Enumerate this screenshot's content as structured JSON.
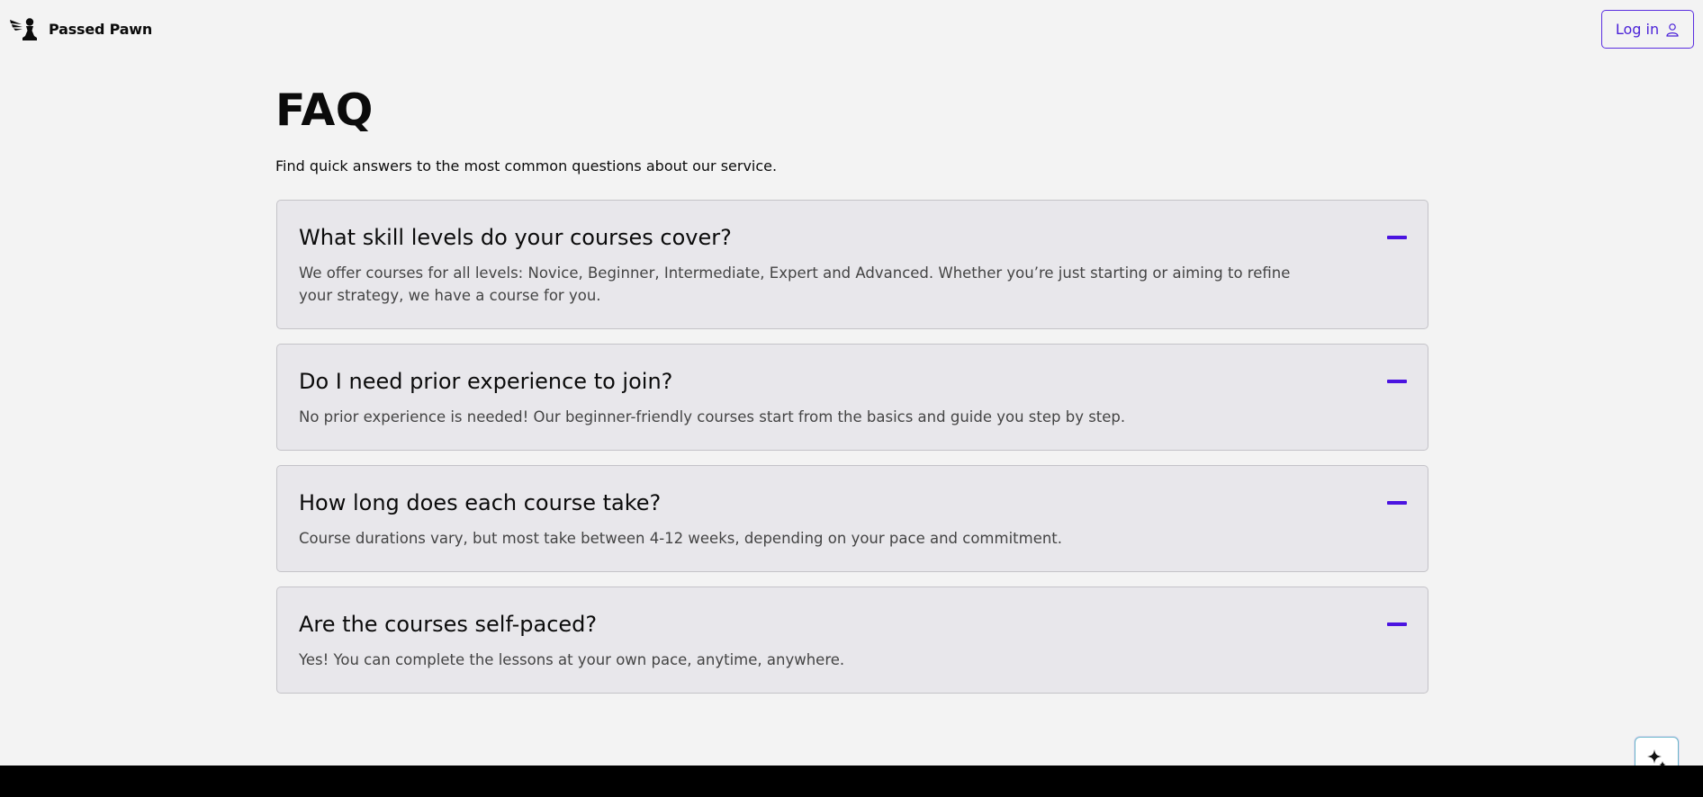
{
  "header": {
    "brand": "Passed Pawn",
    "login_label": "Log in",
    "logo_icon": "winged-pawn-icon",
    "login_icon": "user-icon"
  },
  "faq": {
    "title": "FAQ",
    "subtitle": "Find quick answers to the most common questions about our service.",
    "items": [
      {
        "question": "What skill levels do your courses cover?",
        "answer": "We offer courses for all levels: Novice, Beginner, Intermediate, Expert and Advanced. Whether you’re just starting or aiming to refine your strategy, we have a course for you."
      },
      {
        "question": "Do I need prior experience to join?",
        "answer": "No prior experience is needed! Our beginner-friendly courses start from the basics and guide you step by step."
      },
      {
        "question": "How long does each course take?",
        "answer": "Course durations vary, but most take between 4-12 weeks, depending on your pace and commitment."
      },
      {
        "question": "Are the courses self-paced?",
        "answer": "Yes! You can complete the lessons at your own pace, anytime, anywhere."
      }
    ],
    "toggle_icon": "minus-icon"
  },
  "assistant_icon": "sparkle-icon",
  "colors": {
    "accent": "#4b14e0",
    "background": "#f3f3f3",
    "card": "#e8e7eb",
    "footer": "#000000"
  }
}
